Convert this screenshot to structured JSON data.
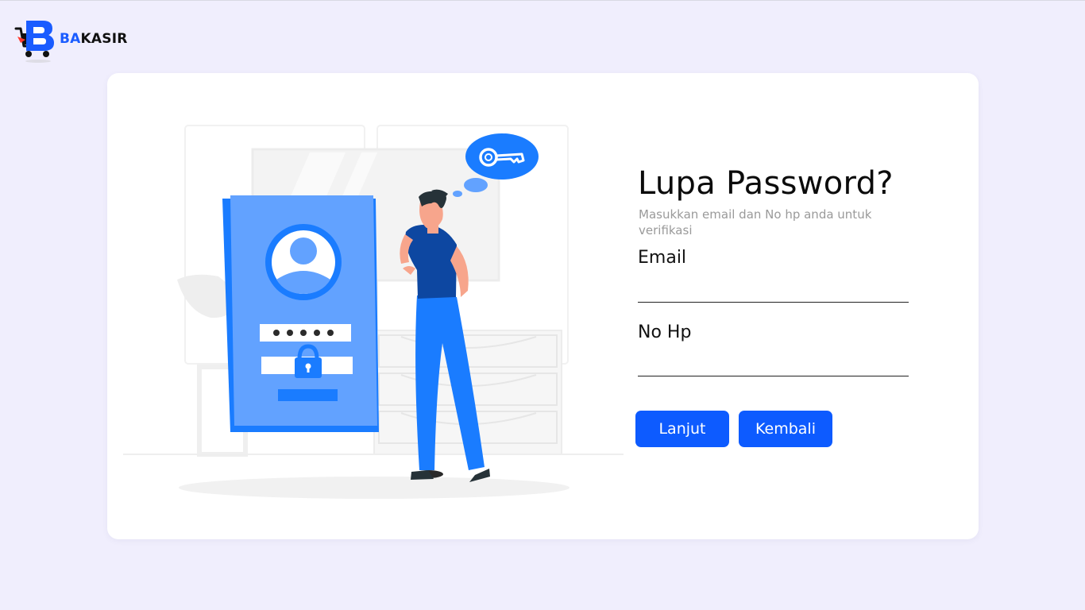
{
  "brand": {
    "ba": "BA",
    "kasir": "KASIR"
  },
  "form": {
    "title": "Lupa Password?",
    "subtitle": "Masukkan email dan No hp anda untuk verifikasi",
    "email_label": "Email",
    "email_value": "",
    "phone_label": "No Hp",
    "phone_value": "",
    "next_label": "Lanjut",
    "back_label": "Kembali"
  },
  "illustration": {
    "password_dots": "● ● ● ● ●"
  },
  "colors": {
    "accent": "#0d5bff",
    "background": "#f0eefd",
    "illustration_blue": "#1a7cff"
  }
}
